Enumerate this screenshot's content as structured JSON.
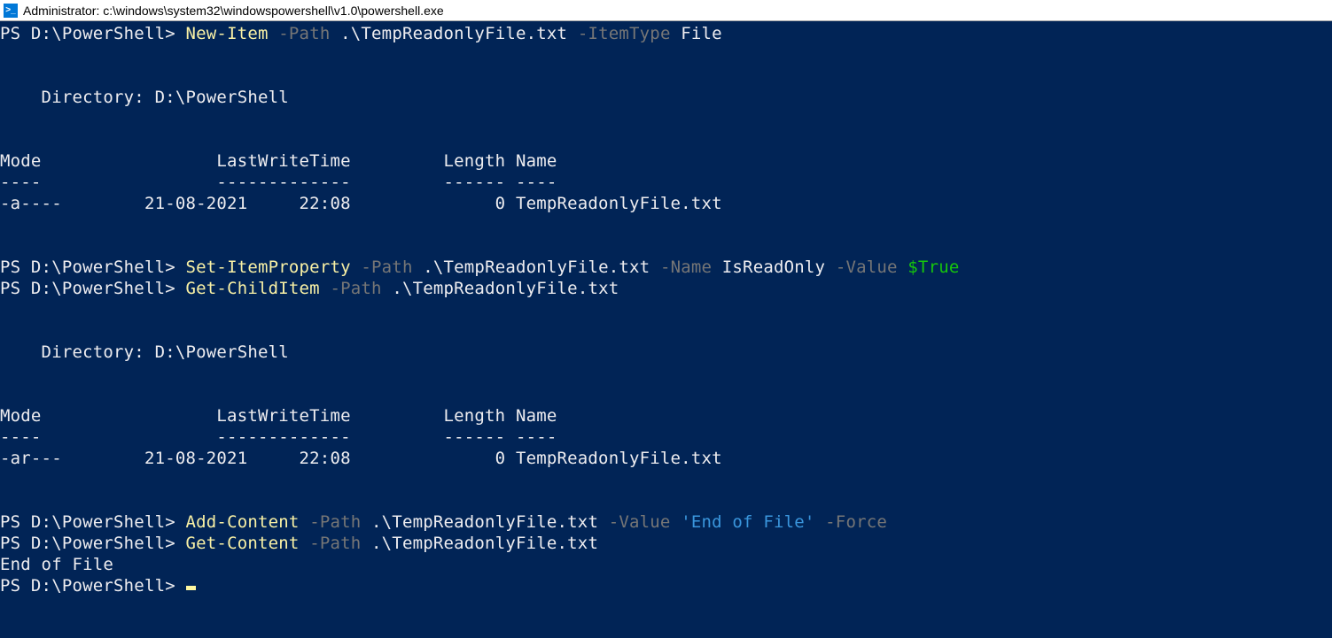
{
  "window": {
    "title": "Administrator: c:\\windows\\system32\\windowspowershell\\v1.0\\powershell.exe",
    "icon_glyph": ">_"
  },
  "colors": {
    "bg": "#012456",
    "fg": "#eeedf0",
    "cmdlet": "#f9f1a5",
    "param": "#767676",
    "value": "#3a96dd",
    "truth": "#16c60c"
  },
  "prompt": "PS D:\\PowerShell> ",
  "lines": [
    {
      "segments": [
        {
          "t": "PS D:\\PowerShell> ",
          "c": "white"
        },
        {
          "t": "New-Item ",
          "c": "yellow"
        },
        {
          "t": "-Path ",
          "c": "gray"
        },
        {
          "t": ".\\TempReadonlyFile.txt ",
          "c": "white"
        },
        {
          "t": "-ItemType ",
          "c": "gray"
        },
        {
          "t": "File",
          "c": "white"
        }
      ]
    },
    {
      "segments": []
    },
    {
      "segments": []
    },
    {
      "segments": [
        {
          "t": "    Directory: D:\\PowerShell",
          "c": "white"
        }
      ]
    },
    {
      "segments": []
    },
    {
      "segments": []
    },
    {
      "segments": [
        {
          "t": "Mode                 LastWriteTime         Length Name",
          "c": "white"
        }
      ]
    },
    {
      "segments": [
        {
          "t": "----                 -------------         ------ ----",
          "c": "white"
        }
      ]
    },
    {
      "segments": [
        {
          "t": "-a----        21-08-2021     22:08              0 TempReadonlyFile.txt",
          "c": "white"
        }
      ]
    },
    {
      "segments": []
    },
    {
      "segments": []
    },
    {
      "segments": [
        {
          "t": "PS D:\\PowerShell> ",
          "c": "white"
        },
        {
          "t": "Set-ItemProperty ",
          "c": "yellow"
        },
        {
          "t": "-Path ",
          "c": "gray"
        },
        {
          "t": ".\\TempReadonlyFile.txt ",
          "c": "white"
        },
        {
          "t": "-Name ",
          "c": "gray"
        },
        {
          "t": "IsReadOnly ",
          "c": "white"
        },
        {
          "t": "-Value ",
          "c": "gray"
        },
        {
          "t": "$True",
          "c": "green"
        }
      ]
    },
    {
      "segments": [
        {
          "t": "PS D:\\PowerShell> ",
          "c": "white"
        },
        {
          "t": "Get-ChildItem ",
          "c": "yellow"
        },
        {
          "t": "-Path ",
          "c": "gray"
        },
        {
          "t": ".\\TempReadonlyFile.txt",
          "c": "white"
        }
      ]
    },
    {
      "segments": []
    },
    {
      "segments": []
    },
    {
      "segments": [
        {
          "t": "    Directory: D:\\PowerShell",
          "c": "white"
        }
      ]
    },
    {
      "segments": []
    },
    {
      "segments": []
    },
    {
      "segments": [
        {
          "t": "Mode                 LastWriteTime         Length Name",
          "c": "white"
        }
      ]
    },
    {
      "segments": [
        {
          "t": "----                 -------------         ------ ----",
          "c": "white"
        }
      ]
    },
    {
      "segments": [
        {
          "t": "-ar---        21-08-2021     22:08              0 TempReadonlyFile.txt",
          "c": "white"
        }
      ]
    },
    {
      "segments": []
    },
    {
      "segments": []
    },
    {
      "segments": [
        {
          "t": "PS D:\\PowerShell> ",
          "c": "white"
        },
        {
          "t": "Add-Content ",
          "c": "yellow"
        },
        {
          "t": "-Path ",
          "c": "gray"
        },
        {
          "t": ".\\TempReadonlyFile.txt ",
          "c": "white"
        },
        {
          "t": "-Value ",
          "c": "gray"
        },
        {
          "t": "'End of File' ",
          "c": "value"
        },
        {
          "t": "-Force",
          "c": "gray"
        }
      ]
    },
    {
      "segments": [
        {
          "t": "PS D:\\PowerShell> ",
          "c": "white"
        },
        {
          "t": "Get-Content ",
          "c": "yellow"
        },
        {
          "t": "-Path ",
          "c": "gray"
        },
        {
          "t": ".\\TempReadonlyFile.txt",
          "c": "white"
        }
      ]
    },
    {
      "segments": [
        {
          "t": "End of File",
          "c": "white"
        }
      ]
    },
    {
      "segments": [
        {
          "t": "PS D:\\PowerShell> ",
          "c": "white"
        }
      ],
      "cursor": true
    }
  ]
}
